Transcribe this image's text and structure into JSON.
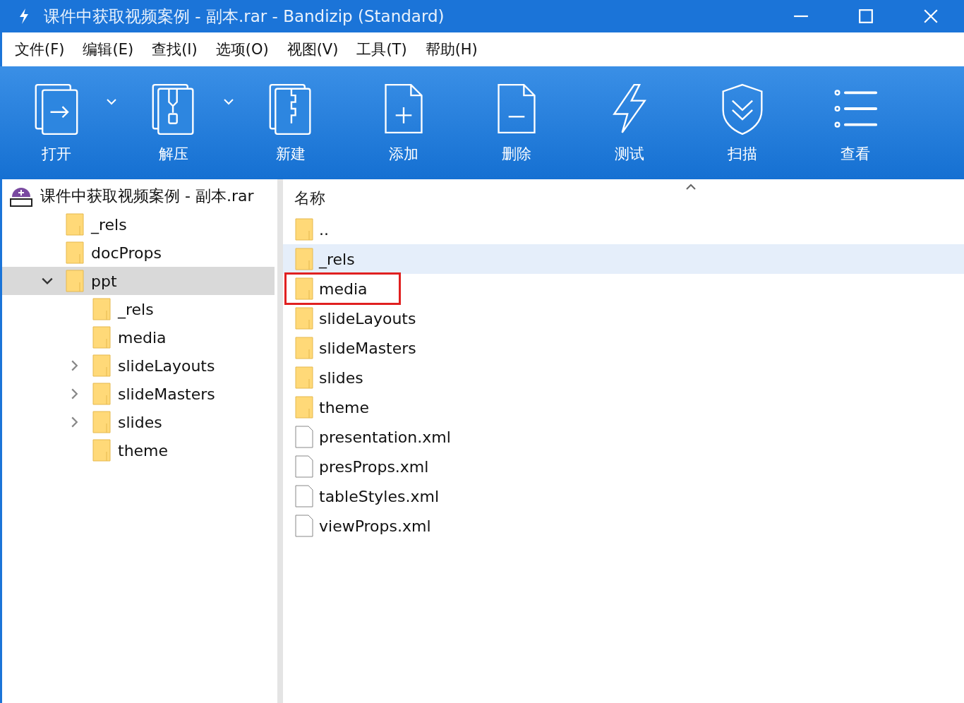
{
  "window": {
    "title": "课件中获取视频案例 - 副本.rar - Bandizip (Standard)"
  },
  "menu": [
    "文件(F)",
    "编辑(E)",
    "查找(I)",
    "选项(O)",
    "视图(V)",
    "工具(T)",
    "帮助(H)"
  ],
  "toolbar": [
    {
      "label": "打开",
      "kind": "open",
      "has_menu": true
    },
    {
      "label": "解压",
      "kind": "extract",
      "has_menu": true
    },
    {
      "label": "新建",
      "kind": "new",
      "has_menu": false
    },
    {
      "label": "添加",
      "kind": "add",
      "has_menu": false
    },
    {
      "label": "删除",
      "kind": "delete",
      "has_menu": false
    },
    {
      "label": "测试",
      "kind": "test",
      "has_menu": false
    },
    {
      "label": "扫描",
      "kind": "scan",
      "has_menu": false
    },
    {
      "label": "查看",
      "kind": "view",
      "has_menu": false
    }
  ],
  "tree": {
    "root": {
      "label": "课件中获取视频案例 - 副本.rar",
      "selected": false,
      "children": [
        {
          "label": "_rels",
          "selected": false
        },
        {
          "label": "docProps",
          "selected": false
        },
        {
          "label": "ppt",
          "selected": true,
          "expanded": true,
          "children": [
            {
              "label": "_rels",
              "selected": false
            },
            {
              "label": "media",
              "selected": false
            },
            {
              "label": "slideLayouts",
              "selected": false,
              "expanded": false
            },
            {
              "label": "slideMasters",
              "selected": false,
              "expanded": false
            },
            {
              "label": "slides",
              "selected": false,
              "expanded": false
            },
            {
              "label": "theme",
              "selected": false
            }
          ]
        }
      ]
    }
  },
  "file_list": {
    "columns": [
      "名称"
    ],
    "items": [
      {
        "name": "..",
        "kind": "folder",
        "selected": false,
        "boxed": false
      },
      {
        "name": "_rels",
        "kind": "folder",
        "selected": true,
        "boxed": false
      },
      {
        "name": "media",
        "kind": "folder",
        "selected": false,
        "boxed": true
      },
      {
        "name": "slideLayouts",
        "kind": "folder",
        "selected": false,
        "boxed": false
      },
      {
        "name": "slideMasters",
        "kind": "folder",
        "selected": false,
        "boxed": false
      },
      {
        "name": "slides",
        "kind": "folder",
        "selected": false,
        "boxed": false
      },
      {
        "name": "theme",
        "kind": "folder",
        "selected": false,
        "boxed": false
      },
      {
        "name": "presentation.xml",
        "kind": "file",
        "selected": false,
        "boxed": false
      },
      {
        "name": "presProps.xml",
        "kind": "file",
        "selected": false,
        "boxed": false
      },
      {
        "name": "tableStyles.xml",
        "kind": "file",
        "selected": false,
        "boxed": false
      },
      {
        "name": "viewProps.xml",
        "kind": "file",
        "selected": false,
        "boxed": false
      }
    ]
  }
}
